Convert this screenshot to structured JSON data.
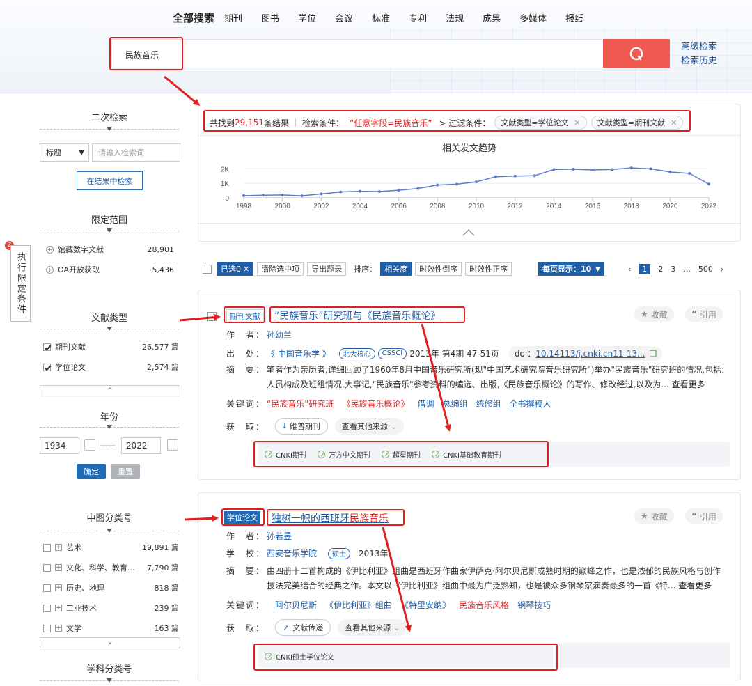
{
  "nav": {
    "items": [
      "全部搜索",
      "期刊",
      "图书",
      "学位",
      "会议",
      "标准",
      "专利",
      "法规",
      "成果",
      "多媒体",
      "报纸"
    ]
  },
  "search": {
    "query": "民族音乐",
    "advanced": "高级检索",
    "history": "检索历史"
  },
  "sidebar": {
    "secondary_search": {
      "title": "二次检索",
      "field": "标题",
      "placeholder": "请输入检索词",
      "button": "在结果中检索"
    },
    "scope": {
      "title": "限定范围",
      "items": [
        {
          "label": "馆藏数字文献",
          "count": "28,901"
        },
        {
          "label": "OA开放获取",
          "count": "5,436"
        }
      ]
    },
    "exec_button": "执行限定条件",
    "exec_badge": "2",
    "doc_type": {
      "title": "文献类型",
      "items": [
        {
          "label": "期刊文献",
          "count": "26,577 篇"
        },
        {
          "label": "学位论文",
          "count": "2,574 篇"
        }
      ],
      "expander": "^"
    },
    "year": {
      "title": "年份",
      "from": "1934",
      "to": "2022",
      "sep": "——",
      "confirm": "确定",
      "reset": "重置"
    },
    "clc": {
      "title": "中图分类号",
      "items": [
        {
          "label": "艺术",
          "count": "19,891 篇"
        },
        {
          "label": "文化、科学、教育...",
          "count": "7,790 篇"
        },
        {
          "label": "历史、地理",
          "count": "818 篇"
        },
        {
          "label": "工业技术",
          "count": "239 篇"
        },
        {
          "label": "文学",
          "count": "163 篇"
        }
      ],
      "expander": "v"
    },
    "subject": {
      "title": "学科分类号"
    }
  },
  "summary": {
    "prefix": "共找到",
    "count": "29,151",
    "suffix": "条结果",
    "cond_label": "检索条件：",
    "cond_value": "“任意字段=民族音乐”",
    "filter_label": "> 过滤条件：",
    "chips": [
      "文献类型=学位论文",
      "文献类型=期刊文献"
    ]
  },
  "chart_data": {
    "type": "line",
    "title": "相关发文趋势",
    "x": [
      1998,
      1999,
      2000,
      2001,
      2002,
      2003,
      2004,
      2005,
      2006,
      2007,
      2008,
      2009,
      2010,
      2011,
      2012,
      2013,
      2014,
      2015,
      2016,
      2017,
      2018,
      2019,
      2020,
      2021,
      2022
    ],
    "values": [
      150,
      180,
      200,
      140,
      270,
      400,
      450,
      430,
      520,
      640,
      880,
      940,
      1100,
      1450,
      1500,
      1520,
      1950,
      1970,
      1920,
      1950,
      2060,
      2000,
      1780,
      1680,
      950
    ],
    "xticks": [
      "1998",
      "2000",
      "2002",
      "2004",
      "2006",
      "2008",
      "2010",
      "2012",
      "2014",
      "2016",
      "2018",
      "2020",
      "2022"
    ],
    "yticks": [
      "0",
      "1K",
      "2K"
    ],
    "ylim": [
      0,
      2400
    ],
    "color": "#5b7ec9"
  },
  "toolbar": {
    "selected": "已选0",
    "clear": "清除选中项",
    "export": "导出题录",
    "sort_label": "排序：",
    "sort_relevance": "相关度",
    "sort_desc": "时效性倒序",
    "sort_asc": "时效性正序",
    "per_page": "每页显示：10",
    "pages": [
      "1",
      "2",
      "3",
      "...",
      "500"
    ],
    "prev": "‹",
    "next": "›"
  },
  "results": [
    {
      "tag": "期刊文献",
      "title": "“民族音乐”研究班与《民族音乐概论》",
      "fields": {
        "author_label": "作　者：",
        "author": "孙幼兰",
        "source_label": "出　处：",
        "source": "《 中国音乐学 》",
        "badges": [
          "北大核心",
          "CSSCI"
        ],
        "issue": "2013年 第4期 47-51页",
        "doi_label": "doi：",
        "doi": "10.14113/j.cnki.cn11-13...",
        "abstract_label": "摘　要：",
        "abstract": "笔者作为亲历者,详细回顾了1960年8月中国音乐研究所(现\"中国艺术研究院音乐研究所\")举办\"民族音乐\"研究班的情况,包括:人员构成及班组情况,大事记,\"民族音乐\"参考资料的编选、出版,《民族音乐概论》的写作、修改经过,以及为...",
        "more": "查看更多",
        "kw_label": "关键词：",
        "keywords": [
          "“民族音乐”研究班",
          "《民族音乐概论》",
          "借调",
          "总编组",
          "统修组",
          "全书撰稿人"
        ]
      },
      "obtain_label": "获　取：",
      "obtain": "维普期刊",
      "other": "查看其他来源",
      "sources": [
        "CNKI期刊",
        "万方中文期刊",
        "超星期刊",
        "CNKI基础教育期刊"
      ],
      "collect": "收藏",
      "cite": "引用"
    },
    {
      "tag": "学位论文",
      "title_pre": "独树一帜的西班牙",
      "title_hl": "民族音乐",
      "fields": {
        "author_label": "作　者：",
        "author": "孙若昱",
        "school_label": "学　校：",
        "school": "西安音乐学院",
        "degree": "硕士",
        "year": "2013年",
        "abstract_label": "摘　要：",
        "abstract": "由四册十二首构成的《伊比利亚》组曲是西班牙作曲家伊萨克·阿尔贝尼斯成熟时期的巅峰之作，也是浓郁的民族风格与创作技法完美结合的经典之作。本文以《伊比利亚》组曲中最为广泛熟知，也是被众多钢琴家演奏最多的一首《特...",
        "more": "查看更多",
        "kw_label": "关键词：",
        "keywords": [
          "阿尔贝尼斯",
          "《伊比利亚》组曲",
          "《特里安纳》",
          "民族音乐风格",
          "钢琴技巧"
        ]
      },
      "obtain_label": "获　取：",
      "obtain": "文献传递",
      "other": "查看其他来源",
      "sources": [
        "CNKI硕士学位论文"
      ],
      "collect": "收藏",
      "cite": "引用"
    }
  ],
  "colors": {
    "accent": "#1f5fa8",
    "search_button": "#f05a50",
    "highlight_box": "#e02020"
  }
}
